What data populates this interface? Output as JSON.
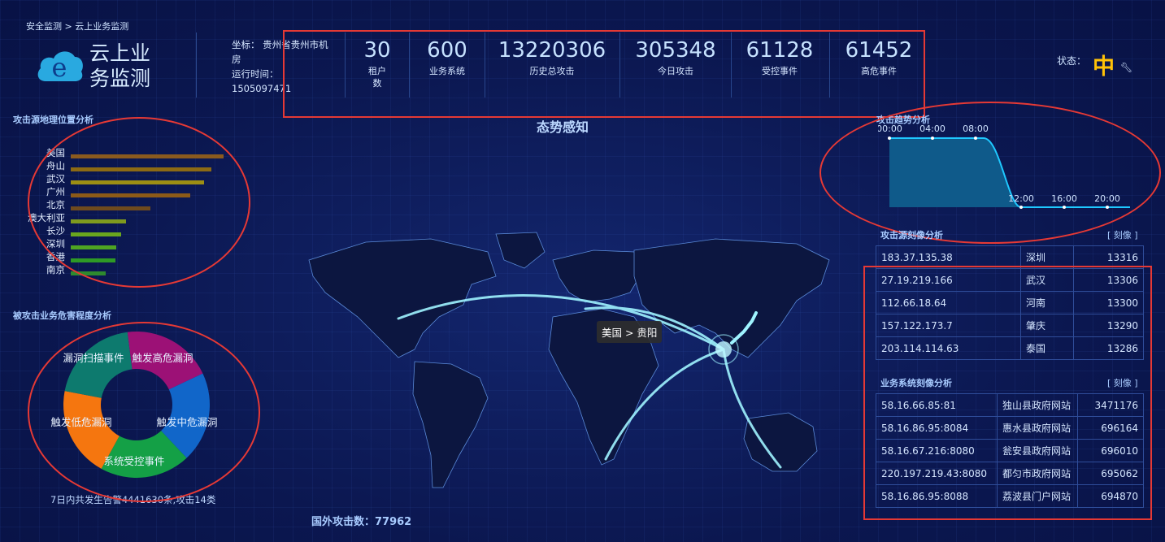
{
  "breadcrumb": {
    "home": "安全监测",
    "sep": ">",
    "current": "云上业务监测"
  },
  "app": {
    "title_line1": "云上业",
    "title_line2": "务监测",
    "logo_letter": "e"
  },
  "meta": {
    "coord": "坐标： 贵州省贵州市机房",
    "runtime": "运行时间：1505097471"
  },
  "stats": [
    {
      "value": "30",
      "label": "租户数"
    },
    {
      "value": "600",
      "label": "业务系统"
    },
    {
      "value": "13220306",
      "label": "历史总攻击"
    },
    {
      "value": "305348",
      "label": "今日攻击"
    },
    {
      "value": "61128",
      "label": "受控事件"
    },
    {
      "value": "61452",
      "label": "高危事件"
    }
  ],
  "status": {
    "label": "状态：",
    "value": "中",
    "icon": "wrench-icon"
  },
  "geo": {
    "title": "攻击源地理位置分析",
    "items": [
      {
        "label": "美国",
        "value": 100,
        "color": "#8a5a1e"
      },
      {
        "label": "舟山",
        "value": 92,
        "color": "#8c6a14"
      },
      {
        "label": "武汉",
        "value": 87,
        "color": "#9c8e14"
      },
      {
        "label": "广州",
        "value": 78,
        "color": "#8c5a18"
      },
      {
        "label": "北京",
        "value": 52,
        "color": "#6e4a1e"
      },
      {
        "label": "澳大利亚",
        "value": 36,
        "color": "#7e9a1e"
      },
      {
        "label": "长沙",
        "value": 33,
        "color": "#6aa61e"
      },
      {
        "label": "深圳",
        "value": 30,
        "color": "#4ea422"
      },
      {
        "label": "香港",
        "value": 29,
        "color": "#2e9a26"
      },
      {
        "label": "南京",
        "value": 23,
        "color": "#2e8a2e"
      }
    ]
  },
  "harm": {
    "title": "被攻击业务危害程度分析",
    "segments": [
      {
        "label": "触发高危漏洞",
        "value": 20,
        "color": "#9c1176"
      },
      {
        "label": "触发中危漏洞",
        "value": 20,
        "color": "#1166c9"
      },
      {
        "label": "系统受控事件",
        "value": 20,
        "color": "#14a046"
      },
      {
        "label": "触发低危漏洞",
        "value": 20,
        "color": "#f5760f"
      },
      {
        "label": "漏洞扫描事件",
        "value": 20,
        "color": "#0d7a6e"
      }
    ],
    "summary": "7日内共发生告警4441630条,攻击14类"
  },
  "map": {
    "title": "态势感知",
    "tooltip": "美国 > 贵阳",
    "foreign": "国外攻击数：77962"
  },
  "trend": {
    "title": "攻击趋势分析",
    "top_labels": [
      "00:00",
      "04:00",
      "08:00"
    ],
    "bottom_labels": [
      "12:00",
      "16:00",
      "20:00"
    ]
  },
  "source_profile": {
    "title": "攻击源刻像分析",
    "tag": "[ 刻像 ]",
    "rows": [
      {
        "ip": "183.37.135.38",
        "place": "深圳",
        "count": "13316"
      },
      {
        "ip": "27.19.219.166",
        "place": "武汉",
        "count": "13306"
      },
      {
        "ip": "112.66.18.64",
        "place": "河南",
        "count": "13300"
      },
      {
        "ip": "157.122.173.7",
        "place": "肇庆",
        "count": "13290"
      },
      {
        "ip": "203.114.114.63",
        "place": "泰国",
        "count": "13286"
      }
    ]
  },
  "biz_profile": {
    "title": "业务系统刻像分析",
    "tag": "[ 刻像 ]",
    "rows": [
      {
        "ip": "58.16.66.85:81",
        "name": "独山县政府网站",
        "count": "3471176"
      },
      {
        "ip": "58.16.86.95:8084",
        "name": "惠水县政府网站",
        "count": "696164"
      },
      {
        "ip": "58.16.67.216:8080",
        "name": "瓮安县政府网站",
        "count": "696010"
      },
      {
        "ip": "220.197.219.43:8080",
        "name": "都匀市政府网站",
        "count": "695062"
      },
      {
        "ip": "58.16.86.95:8088",
        "name": "荔波县门户网站",
        "count": "694870"
      }
    ]
  },
  "colors": {
    "accent": "#1fc8ff",
    "highlight": "#e53935",
    "status": "#ffc107"
  }
}
